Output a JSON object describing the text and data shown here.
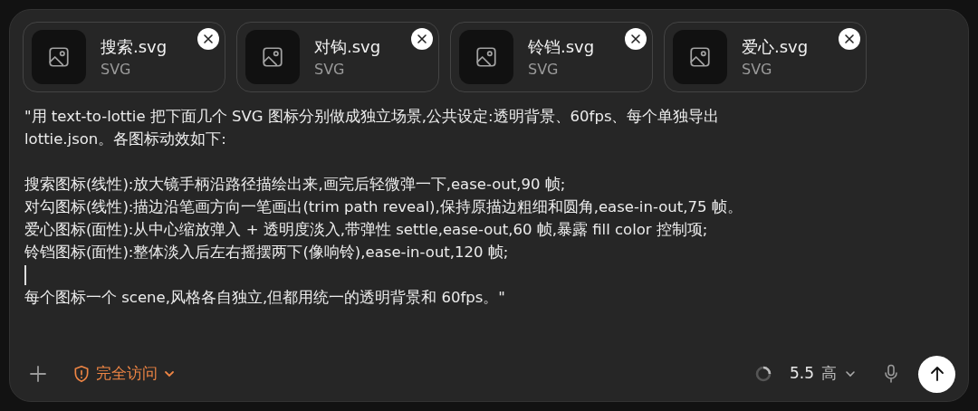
{
  "attachments": [
    {
      "name": "搜索.svg",
      "type": "SVG"
    },
    {
      "name": "对钩.svg",
      "type": "SVG"
    },
    {
      "name": "铃铛.svg",
      "type": "SVG"
    },
    {
      "name": "爱心.svg",
      "type": "SVG"
    }
  ],
  "prompt": [
    {
      "kind": "text",
      "text": "\"用 text-to-lottie 把下面几个 SVG 图标分别做成独立场景,公共设定:透明背景、60fps、每个单独导出"
    },
    {
      "kind": "text",
      "text": "lottie.json。各图标动效如下:"
    },
    {
      "kind": "blank"
    },
    {
      "kind": "text",
      "text": "搜索图标(线性):放大镜手柄沿路径描绘出来,画完后轻微弹一下,ease-out,90 帧;"
    },
    {
      "kind": "text",
      "text": "对勾图标(线性):描边沿笔画方向一笔画出(trim path reveal),保持原描边粗细和圆角,ease-in-out,75 帧。"
    },
    {
      "kind": "text",
      "text": "爱心图标(面性):从中心缩放弹入 + 透明度淡入,带弹性 settle,ease-out,60 帧,暴露 fill color 控制项;"
    },
    {
      "kind": "text",
      "text": "铃铛图标(面性):整体淡入后左右摇摆两下(像响铃),ease-in-out,120 帧;"
    },
    {
      "kind": "cursor"
    },
    {
      "kind": "text",
      "text": "每个图标一个 scene,风格各自独立,但都用统一的透明背景和 60fps。\""
    }
  ],
  "toolbar": {
    "access": "完全访问",
    "model": "5.5",
    "effort": "高"
  }
}
